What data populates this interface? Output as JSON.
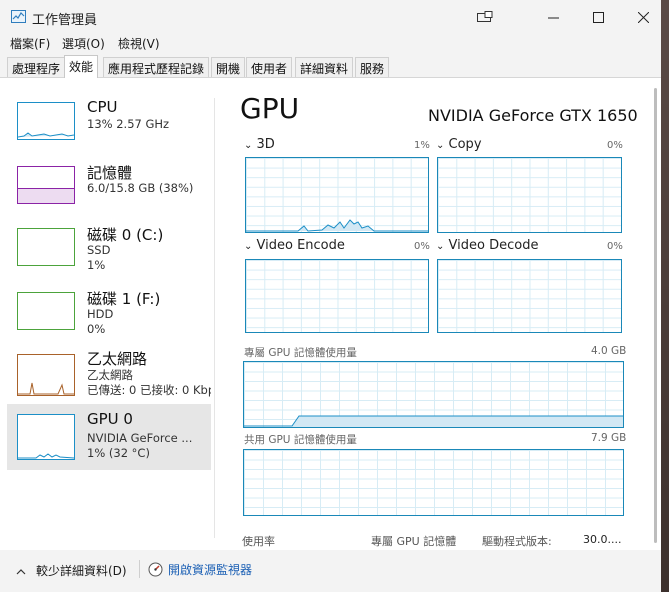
{
  "window": {
    "title": "工作管理員"
  },
  "menu": [
    "檔案(F)",
    "選項(O)",
    "檢視(V)"
  ],
  "tabs": [
    "處理程序",
    "效能",
    "應用程式歷程記錄",
    "開機",
    "使用者",
    "詳細資料",
    "服務"
  ],
  "sidebar": [
    {
      "title": "CPU",
      "sub1": "13%  2.57 GHz",
      "sub2": "",
      "icon": "cpu-graph",
      "color": "#1c8fc7"
    },
    {
      "title": "記憶體",
      "sub1": "6.0/15.8 GB (38%)",
      "sub2": "",
      "icon": "memory-graph",
      "color": "#8b23a6"
    },
    {
      "title": "磁碟 0 (C:)",
      "sub1": "SSD",
      "sub2": "1%",
      "icon": "disk-graph",
      "color": "#4ca33b"
    },
    {
      "title": "磁碟 1 (F:)",
      "sub1": "HDD",
      "sub2": "0%",
      "icon": "disk-graph",
      "color": "#4ca33b"
    },
    {
      "title": "乙太網路",
      "sub1": "乙太網路",
      "sub2": "已傳送: 0  已接收: 0 Kbp",
      "icon": "network-graph",
      "color": "#a9622a"
    },
    {
      "title": "GPU 0",
      "sub1": "NVIDIA GeForce ...",
      "sub2": "1% (32 °C)",
      "icon": "gpu-graph",
      "color": "#1c8fc7"
    }
  ],
  "main": {
    "heading": "GPU",
    "gpu_name": "NVIDIA GeForce GTX 1650",
    "engines": [
      {
        "label": "3D",
        "value": "1%"
      },
      {
        "label": "Copy",
        "value": "0%"
      },
      {
        "label": "Video Encode",
        "value": "0%"
      },
      {
        "label": "Video Decode",
        "value": "0%"
      }
    ],
    "dedicated": {
      "label": "專屬 GPU 記憶體使用量",
      "max": "4.0 GB"
    },
    "shared": {
      "label": "共用 GPU 記憶體使用量",
      "max": "7.9 GB"
    },
    "stats": {
      "utilization": "使用率",
      "dedicated_mem": "專屬 GPU 記憶體",
      "driver_label": "驅動程式版本:",
      "driver_value": "30.0...."
    }
  },
  "footer": {
    "less_details": "較少詳細資料(D)",
    "resource_monitor": "開啟資源監視器"
  },
  "colors": {
    "accent": "#1a88b8"
  }
}
